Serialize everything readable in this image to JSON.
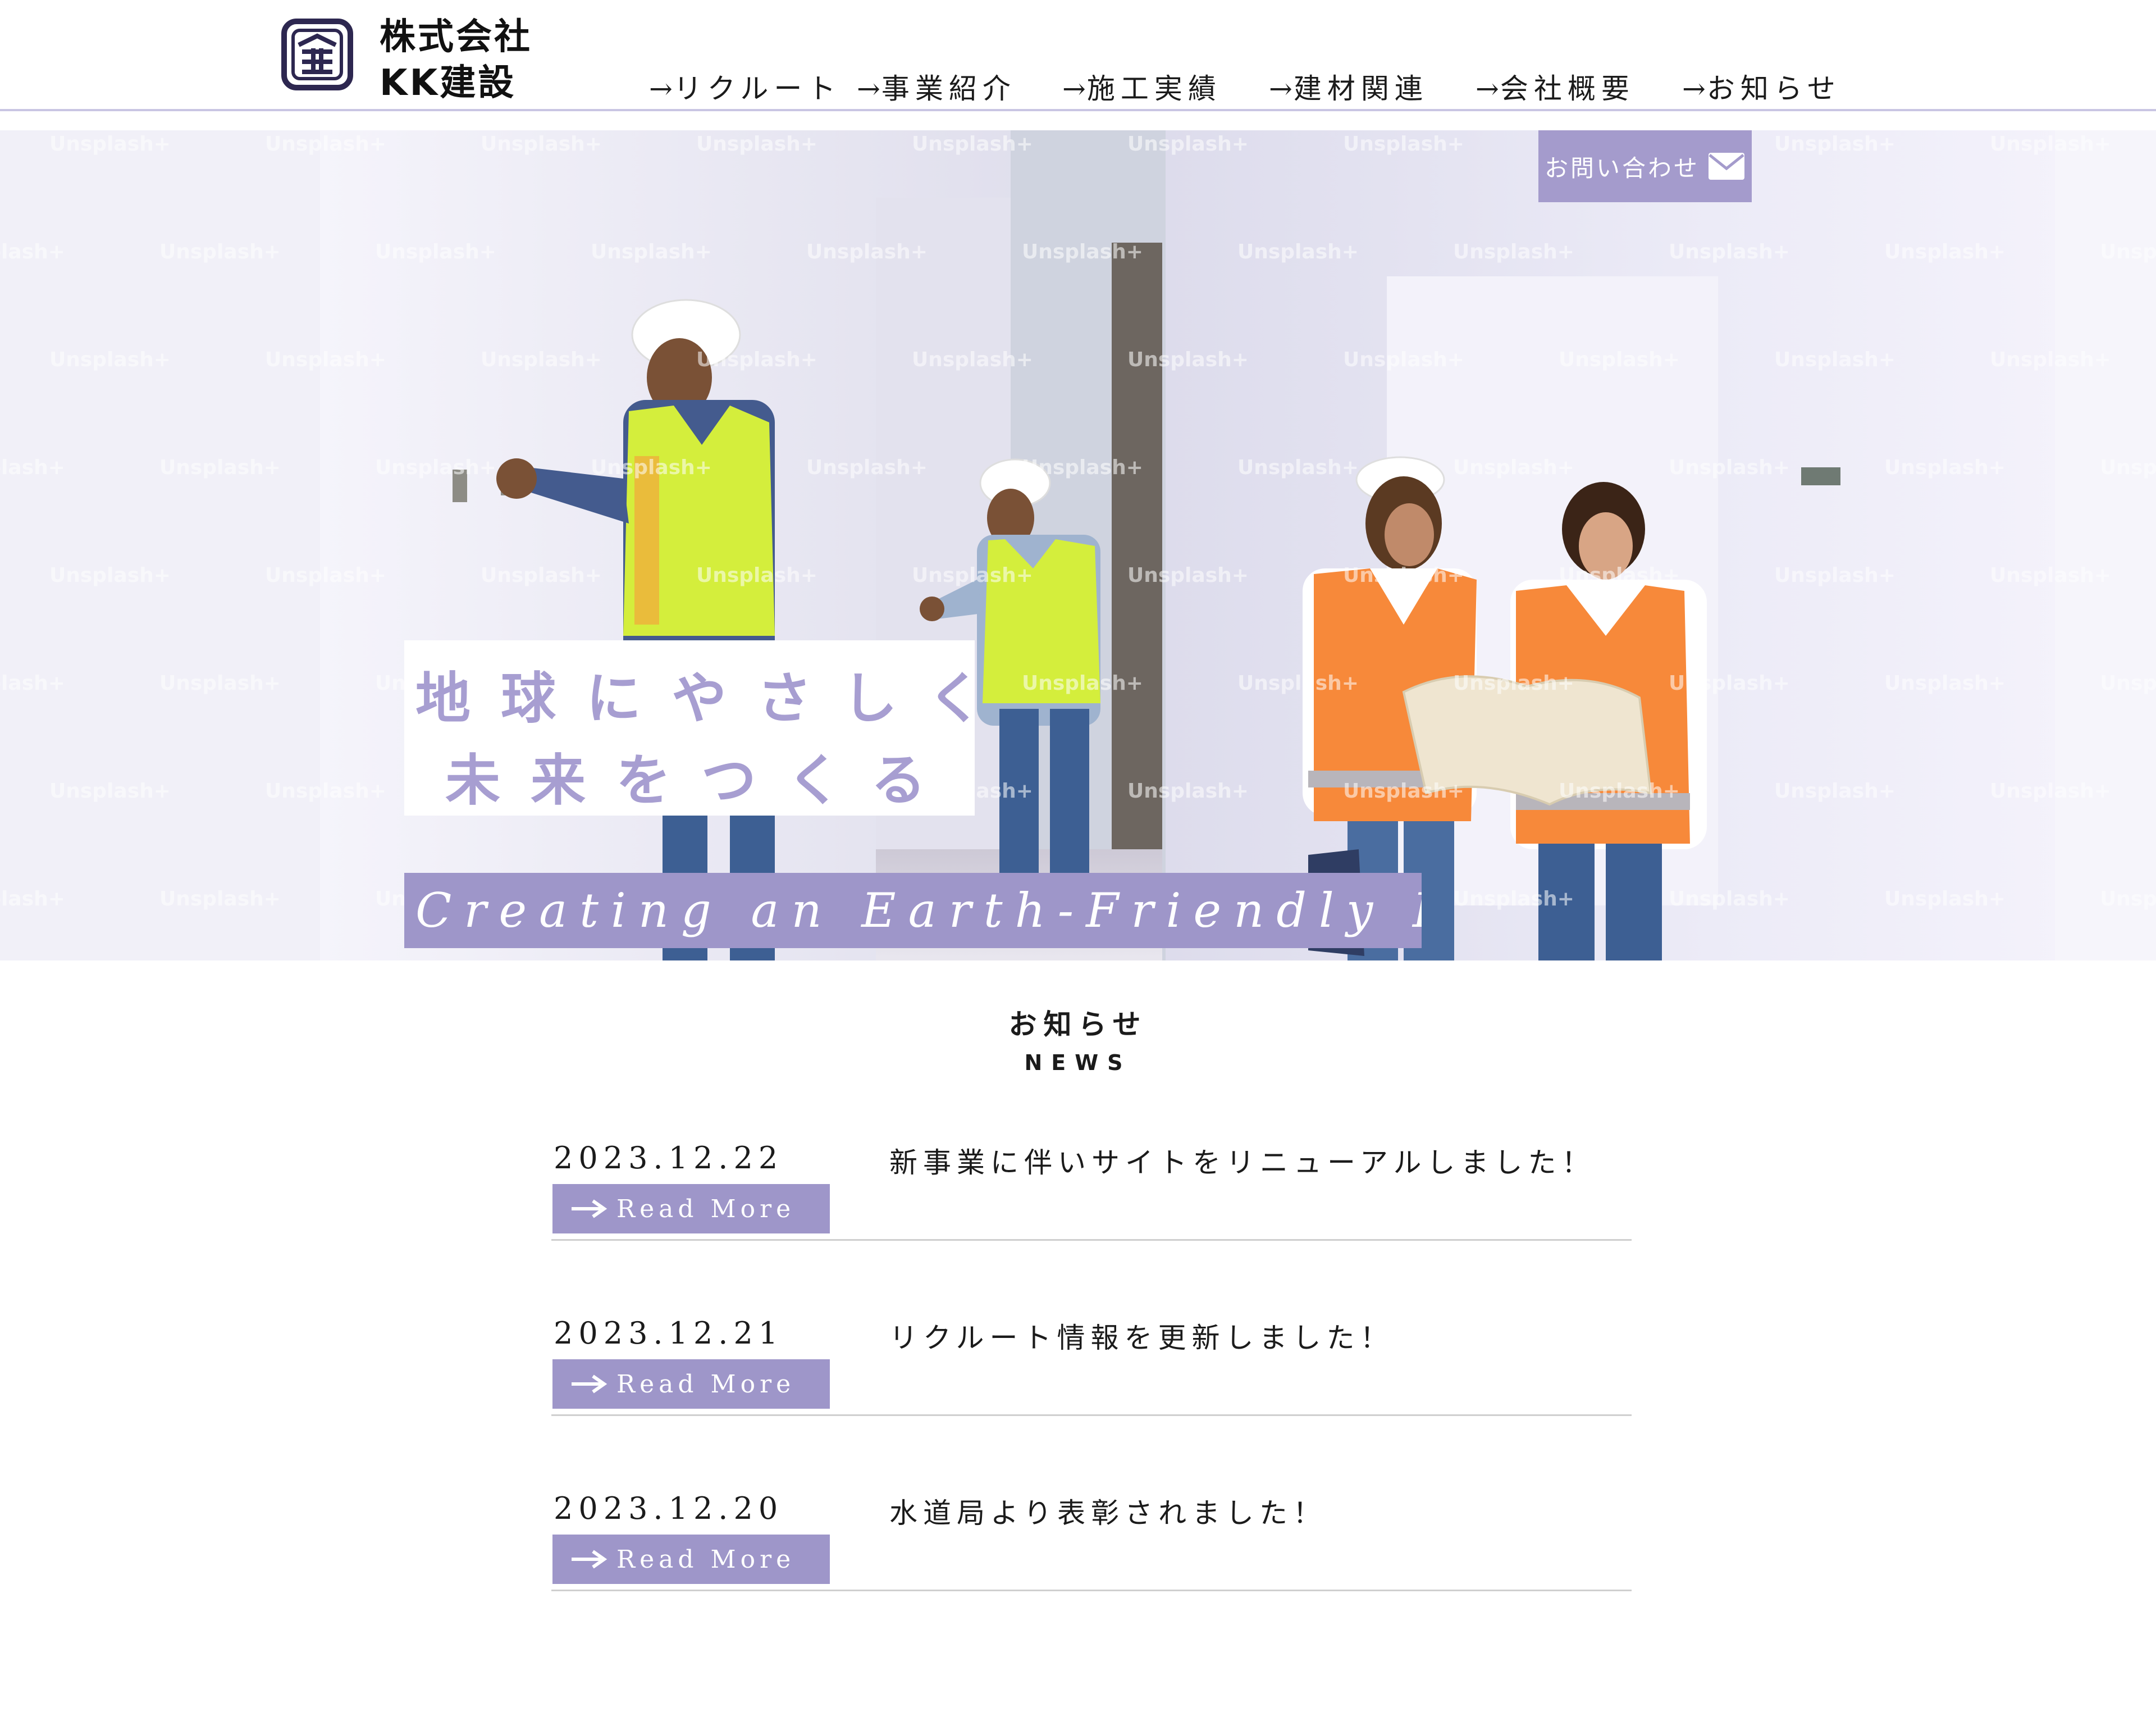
{
  "header": {
    "logo_line1": "株式会社",
    "logo_line2": "KK建設",
    "logo_icon": "building-emblem-icon",
    "nav": [
      {
        "arrow": "→",
        "label": "リクルート"
      },
      {
        "arrow": "→",
        "label": "事業紹介"
      },
      {
        "arrow": "→",
        "label": "施工実績"
      },
      {
        "arrow": "→",
        "label": "建材関連"
      },
      {
        "arrow": "→",
        "label": "会社概要"
      },
      {
        "arrow": "→",
        "label": "お知らせ"
      }
    ]
  },
  "hero": {
    "contact_label": "お問い合わせ",
    "contact_icon": "mail-icon",
    "tagline_line1": "地球にやさしく",
    "tagline_line2": "未来をつくる",
    "script_text": "Creating an Earth-Friendly Future",
    "watermark": "Unsplash+"
  },
  "news": {
    "title": "お知らせ",
    "subtitle": "NEWS",
    "read_more_label": "Read More",
    "items": [
      {
        "date": "2023.12.22",
        "text": "新事業に伴いサイトをリニューアルしました！"
      },
      {
        "date": "2023.12.21",
        "text": "リクルート情報を更新しました！"
      },
      {
        "date": "2023.12.20",
        "text": "水道局より表彰されました！"
      }
    ]
  },
  "colors": {
    "accent": "#9e96c9",
    "tagline_text": "#a79ed1",
    "header_rule": "#c9c5e3"
  }
}
